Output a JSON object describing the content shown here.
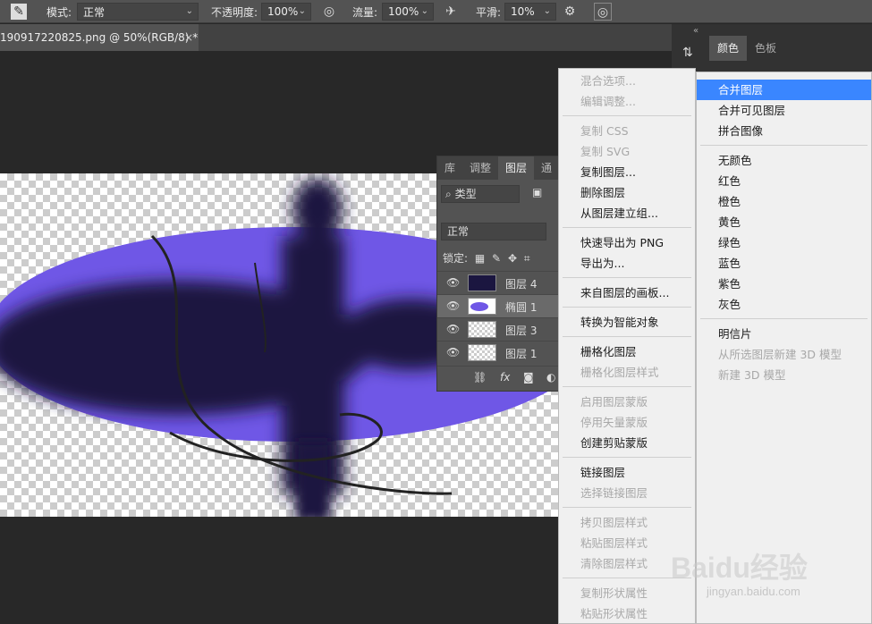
{
  "options_bar": {
    "mode_label": "模式:",
    "mode_value": "正常",
    "opacity_label": "不透明度:",
    "opacity_value": "100%",
    "flow_label": "流量:",
    "flow_value": "100%",
    "smoothing_label": "平滑:",
    "smoothing_value": "10%"
  },
  "document_tab": {
    "title": "190917220825.png @ 50%(RGB/8) *",
    "close": "×"
  },
  "color_panel": {
    "tabs": [
      "颜色",
      "色板"
    ]
  },
  "layers_panel": {
    "tabs": [
      "库",
      "调整",
      "图层",
      "通"
    ],
    "filter_label": "类型",
    "blend_mode": "正常",
    "lock_label": "锁定:",
    "layers": [
      {
        "name": "图层 4",
        "visible": true,
        "selected": false
      },
      {
        "name": "椭圆 1",
        "visible": true,
        "selected": true
      },
      {
        "name": "图层 3",
        "visible": true,
        "selected": false
      },
      {
        "name": "图层 1",
        "visible": true,
        "selected": false
      }
    ],
    "footer_fx": "fx"
  },
  "context_menu": {
    "groups": [
      [
        {
          "label": "混合选项...",
          "disabled": true
        },
        {
          "label": "编辑调整...",
          "disabled": true
        }
      ],
      [
        {
          "label": "复制 CSS",
          "disabled": true
        },
        {
          "label": "复制 SVG",
          "disabled": true
        },
        {
          "label": "复制图层...",
          "disabled": false
        },
        {
          "label": "删除图层",
          "disabled": false
        },
        {
          "label": "从图层建立组...",
          "disabled": false
        }
      ],
      [
        {
          "label": "快速导出为 PNG",
          "disabled": false
        },
        {
          "label": "导出为...",
          "disabled": false
        }
      ],
      [
        {
          "label": "来自图层的画板...",
          "disabled": false
        }
      ],
      [
        {
          "label": "转换为智能对象",
          "disabled": false
        }
      ],
      [
        {
          "label": "栅格化图层",
          "disabled": false
        },
        {
          "label": "栅格化图层样式",
          "disabled": true
        }
      ],
      [
        {
          "label": "启用图层蒙版",
          "disabled": true
        },
        {
          "label": "停用矢量蒙版",
          "disabled": true
        },
        {
          "label": "创建剪贴蒙版",
          "disabled": false
        }
      ],
      [
        {
          "label": "链接图层",
          "disabled": false
        },
        {
          "label": "选择链接图层",
          "disabled": true
        }
      ],
      [
        {
          "label": "拷贝图层样式",
          "disabled": true
        },
        {
          "label": "粘贴图层样式",
          "disabled": true
        },
        {
          "label": "清除图层样式",
          "disabled": true
        }
      ],
      [
        {
          "label": "复制形状属性",
          "disabled": true
        },
        {
          "label": "粘贴形状属性",
          "disabled": true
        }
      ]
    ]
  },
  "context_menu_right": {
    "groups": [
      [
        {
          "label": "合并图层",
          "disabled": false,
          "highlighted": true
        },
        {
          "label": "合并可见图层",
          "disabled": false
        },
        {
          "label": "拼合图像",
          "disabled": false
        }
      ],
      [
        {
          "label": "无颜色",
          "disabled": false
        },
        {
          "label": "红色",
          "disabled": false
        },
        {
          "label": "橙色",
          "disabled": false
        },
        {
          "label": "黄色",
          "disabled": false
        },
        {
          "label": "绿色",
          "disabled": false
        },
        {
          "label": "蓝色",
          "disabled": false
        },
        {
          "label": "紫色",
          "disabled": false
        },
        {
          "label": "灰色",
          "disabled": false
        }
      ],
      [
        {
          "label": "明信片",
          "disabled": false
        },
        {
          "label": "从所选图层新建 3D 模型",
          "disabled": true
        },
        {
          "label": "新建 3D 模型",
          "disabled": true
        }
      ]
    ]
  },
  "watermark": {
    "brand": "Baidu经验",
    "url": "jingyan.baidu.com"
  },
  "colors": {
    "ellipse": "#6f57e6",
    "shadow": "#1b1640",
    "highlight": "#3a86ff"
  }
}
